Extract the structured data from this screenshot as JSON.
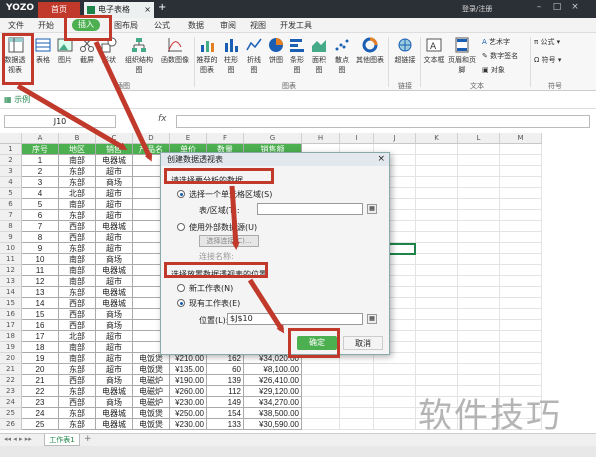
{
  "titlebar": {
    "logo": "YOZO",
    "home_tab": "首页",
    "doc_tab": "电子表格",
    "login": "登录/注册"
  },
  "menu": {
    "items": [
      "文件",
      "开始",
      "插入",
      "图布局",
      "公式",
      "数据",
      "审阅",
      "视图",
      "开发工具"
    ]
  },
  "ribbon": {
    "buttons": [
      "数据透视表",
      "表格",
      "图片",
      "截屏",
      "形状",
      "组织结构图",
      "函数图像",
      "推荐的图表",
      "柱形图",
      "折线图",
      "饼图",
      "条形图",
      "面积图",
      "散点图",
      "其他图表",
      "超链接",
      "文本框",
      "页眉和页脚",
      "艺术字",
      "数字签名",
      "对象",
      "公式",
      "符号"
    ],
    "groups": [
      "插图",
      "图表",
      "链接",
      "文本",
      "符号"
    ]
  },
  "quickbar": {
    "sheet_name": "示例"
  },
  "formula": {
    "namebox": "J10",
    "fx": "fx",
    "value": ""
  },
  "grid": {
    "columns": [
      "A",
      "B",
      "C",
      "D",
      "E",
      "F",
      "G",
      "H",
      "I",
      "J",
      "K",
      "L",
      "M"
    ],
    "headers": [
      "序号",
      "地区",
      "销售",
      "产品名",
      "单价",
      "数量",
      "销售额"
    ],
    "rows": [
      [
        "1",
        "南部",
        "电器城",
        "",
        "",
        "",
        ""
      ],
      [
        "2",
        "东部",
        "超市",
        "",
        "",
        "",
        ""
      ],
      [
        "3",
        "东部",
        "商场",
        "",
        "",
        "",
        ""
      ],
      [
        "4",
        "北部",
        "超市",
        "",
        "",
        "",
        ""
      ],
      [
        "5",
        "南部",
        "超市",
        "",
        "",
        "",
        ""
      ],
      [
        "6",
        "东部",
        "超市",
        "",
        "",
        "",
        ""
      ],
      [
        "7",
        "西部",
        "电器城",
        "",
        "",
        "",
        ""
      ],
      [
        "8",
        "西部",
        "超市",
        "",
        "",
        "",
        ""
      ],
      [
        "9",
        "东部",
        "超市",
        "",
        "",
        "",
        ""
      ],
      [
        "10",
        "南部",
        "商场",
        "",
        "",
        "",
        ""
      ],
      [
        "11",
        "南部",
        "电器城",
        "",
        "",
        "",
        ""
      ],
      [
        "12",
        "南部",
        "超市",
        "",
        "",
        "",
        ""
      ],
      [
        "13",
        "东部",
        "电器城",
        "",
        "",
        "",
        ""
      ],
      [
        "14",
        "西部",
        "电器城",
        "",
        "",
        "",
        ""
      ],
      [
        "15",
        "西部",
        "商场",
        "",
        "",
        "",
        ""
      ],
      [
        "16",
        "西部",
        "商场",
        "",
        "",
        "",
        ""
      ],
      [
        "17",
        "北部",
        "超市",
        "",
        "",
        "",
        ""
      ],
      [
        "18",
        "南部",
        "超市",
        "",
        "",
        "",
        ""
      ],
      [
        "19",
        "南部",
        "超市",
        "电饭煲",
        "¥210.00",
        "162",
        "¥34,020.00"
      ],
      [
        "20",
        "东部",
        "超市",
        "电饭煲",
        "¥135.00",
        "60",
        "¥8,100.00"
      ],
      [
        "21",
        "西部",
        "商场",
        "电磁炉",
        "¥190.00",
        "139",
        "¥26,410.00"
      ],
      [
        "22",
        "东部",
        "电器城",
        "电磁炉",
        "¥260.00",
        "112",
        "¥29,120.00"
      ],
      [
        "23",
        "西部",
        "商场",
        "电磁炉",
        "¥230.00",
        "149",
        "¥34,270.00"
      ],
      [
        "24",
        "东部",
        "电器城",
        "电饭煲",
        "¥250.00",
        "154",
        "¥38,500.00"
      ],
      [
        "25",
        "东部",
        "电器城",
        "电饭煲",
        "¥230.00",
        "133",
        "¥30,590.00"
      ]
    ],
    "row_numbers": [
      "1",
      "2",
      "3",
      "4",
      "5",
      "6",
      "7",
      "8",
      "9",
      "10",
      "11",
      "12",
      "13",
      "14",
      "15",
      "16",
      "17",
      "18",
      "19",
      "20",
      "21",
      "22",
      "23",
      "24",
      "25",
      "26"
    ]
  },
  "sheettabs": {
    "active": "工作表1"
  },
  "dialog": {
    "title": "创建数据透视表",
    "section1": "请选择要分析的数据",
    "opt_select_range": "选择一个单元格区域(S)",
    "table_range_label": "表/区域(T):",
    "opt_external": "使用外部数据源(U)",
    "choose_connection": "选择连接(C)...",
    "connection_name": "连接名称:",
    "section2": "选择放置数据透视表的位置",
    "opt_new_sheet": "新工作表(N)",
    "opt_existing": "现有工作表(E)",
    "location_label": "位置(L):",
    "location_value": "$J$10",
    "ok": "确定",
    "cancel": "取消"
  },
  "watermark": "软件技巧",
  "colors": {
    "accent": "#4caf50",
    "highlight": "#c0392b",
    "titlebar": "#2b2f36"
  }
}
